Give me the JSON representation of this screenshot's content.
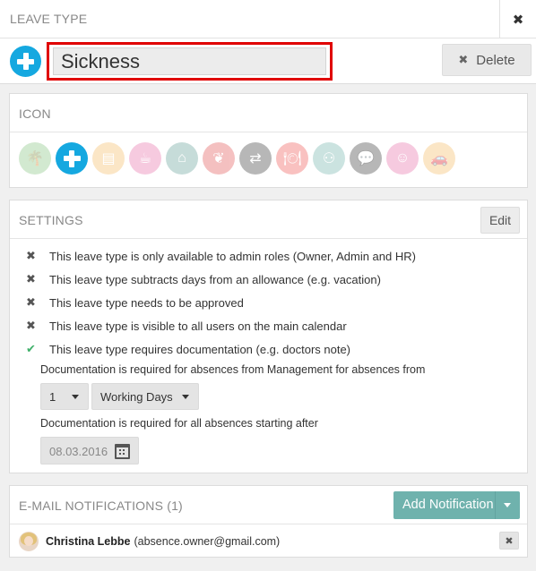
{
  "header": {
    "title": "LEAVE TYPE",
    "close_glyph": "✖"
  },
  "name_row": {
    "name_value": "Sickness",
    "delete_label": "Delete",
    "delete_glyph": "✖"
  },
  "icon_panel": {
    "title": "ICON",
    "icons": [
      {
        "name": "palm-tree-icon",
        "color": "#7fc27a",
        "glyph": "🌴",
        "selected": false
      },
      {
        "name": "plus-icon",
        "color": "#15a8e0",
        "glyph": "",
        "selected": true
      },
      {
        "name": "briefcase-icon",
        "color": "#f5b85f",
        "glyph": "▤",
        "selected": false
      },
      {
        "name": "coffee-cup-icon",
        "color": "#e86ba6",
        "glyph": "☕",
        "selected": false
      },
      {
        "name": "house-icon",
        "color": "#5e9d94",
        "glyph": "⌂",
        "selected": false
      },
      {
        "name": "leaf-icon",
        "color": "#e24d4d",
        "glyph": "❦",
        "selected": false
      },
      {
        "name": "sync-icon",
        "color": "#333333",
        "glyph": "⇄",
        "selected": false
      },
      {
        "name": "cutlery-icon",
        "color": "#f0504d",
        "glyph": "🍽",
        "selected": false
      },
      {
        "name": "people-circle-icon",
        "color": "#6cb1a8",
        "glyph": "⚇",
        "selected": false
      },
      {
        "name": "speech-bubbles-icon",
        "color": "#333333",
        "glyph": "💬",
        "selected": false
      },
      {
        "name": "baby-face-icon",
        "color": "#e86ba6",
        "glyph": "☺",
        "selected": false
      },
      {
        "name": "car-icon",
        "color": "#f5b85f",
        "glyph": "🚗",
        "selected": false
      }
    ]
  },
  "settings": {
    "title": "SETTINGS",
    "edit_label": "Edit",
    "rows": [
      {
        "mark": "✖",
        "ok": false,
        "text": "This leave type is only available to admin roles (Owner, Admin and HR)"
      },
      {
        "mark": "✖",
        "ok": false,
        "text": "This leave type subtracts days from an allowance (e.g. vacation)"
      },
      {
        "mark": "✖",
        "ok": false,
        "text": "This leave type needs to be approved"
      },
      {
        "mark": "✖",
        "ok": false,
        "text": "This leave type is visible to all users on the main calendar"
      },
      {
        "mark": "✔",
        "ok": true,
        "text": "This leave type requires documentation (e.g. doctors note)"
      }
    ],
    "doc_management_label": "Documentation is required for absences from Management for absences from",
    "amount_value": "1",
    "unit_value": "Working Days",
    "doc_all_label": "Documentation is required for all absences starting after",
    "date_value": "08.03.2016"
  },
  "notifications": {
    "title": "E-MAIL NOTIFICATIONS (1)",
    "add_label": "Add Notification",
    "recipient_name": "Christina Lebbe",
    "recipient_email": "(absence.owner@gmail.com)",
    "remove_glyph": "✖"
  },
  "colors": {
    "accent": "#15a8e0",
    "highlight_outline": "#e00000",
    "button_teal": "#6fb2ad",
    "check_green": "#3fb06a"
  }
}
